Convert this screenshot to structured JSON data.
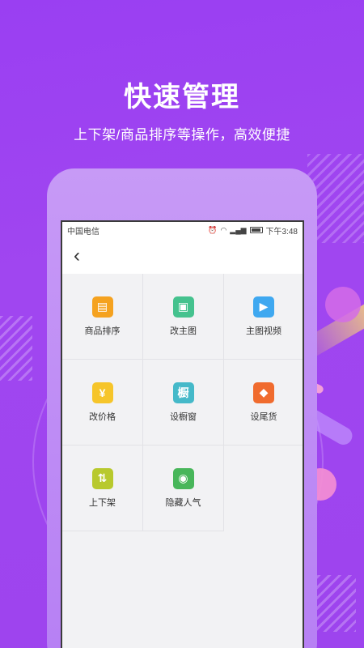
{
  "promo": {
    "title": "快速管理",
    "subtitle": "上下架/商品排序等操作，高效便捷"
  },
  "statusbar": {
    "carrier": "中国电信",
    "time": "下午3:48"
  },
  "grid": [
    {
      "label": "商品排序",
      "icon": "sort-box-icon",
      "color": "#f5a21f",
      "glyph": "▤"
    },
    {
      "label": "改主图",
      "icon": "image-icon",
      "color": "#45c28e",
      "glyph": "▣"
    },
    {
      "label": "主图视频",
      "icon": "play-icon",
      "color": "#3fa8f0",
      "glyph": "▶"
    },
    {
      "label": "改价格",
      "icon": "yen-coin-icon",
      "color": "#f6c52a",
      "glyph": "¥"
    },
    {
      "label": "设橱窗",
      "icon": "showcase-icon",
      "color": "#45b9c9",
      "glyph": "橱"
    },
    {
      "label": "设尾货",
      "icon": "tag-icon",
      "color": "#f06b2e",
      "glyph": "◆"
    },
    {
      "label": "上下架",
      "icon": "up-down-arrows-icon",
      "color": "#b8c92d",
      "glyph": "⇅"
    },
    {
      "label": "隐藏人气",
      "icon": "hidden-eye-icon",
      "color": "#48b65a",
      "glyph": "◉"
    }
  ]
}
